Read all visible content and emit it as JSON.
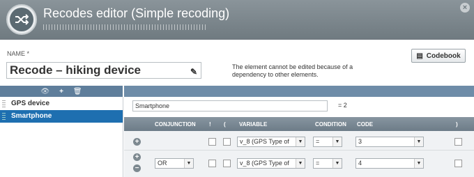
{
  "window": {
    "title": "Recodes editor (Simple recoding)",
    "close_icon": "close-icon",
    "app_icon": "shuffle-icon"
  },
  "form": {
    "name_label": "NAME *",
    "name_value": "Recode – hiking device",
    "notice": "The element cannot be edited because of a dependency to other elements.",
    "codebook_label": "Codebook"
  },
  "list": {
    "header_icons": [
      "eye-icon",
      "plus-icon",
      "trash-icon"
    ],
    "items": [
      {
        "label": "GPS device",
        "selected": false
      },
      {
        "label": "Smartphone",
        "selected": true
      }
    ]
  },
  "detail": {
    "label_value": "Smartphone",
    "code_value": "= 2",
    "columns": {
      "conjunction": "CONJUNCTION",
      "not": "!",
      "open": "(",
      "variable": "VARIABLE",
      "condition": "CONDITION",
      "code": "CODE",
      "close": ")"
    },
    "rows": [
      {
        "conjunction": "",
        "variable": "v_8 (GPS Type of",
        "condition": "=",
        "code": "3"
      },
      {
        "conjunction": "OR",
        "variable": "v_8 (GPS Type of",
        "condition": "=",
        "code": "4"
      }
    ]
  },
  "colors": {
    "titlebar": "#7a858b",
    "selected": "#1e6fb0",
    "header": "#6e8ca8"
  }
}
